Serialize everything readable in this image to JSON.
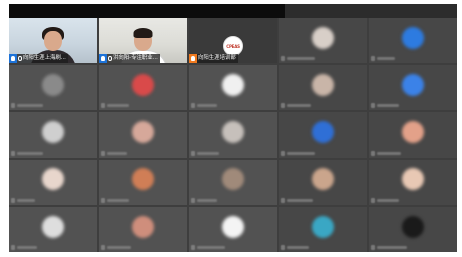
{
  "participants_featured": [
    {
      "name": "向阳生涯上海刷...",
      "icon": "person-icon",
      "mic": "mic-icon",
      "badge_color": "#1e73d8"
    },
    {
      "name": "洪向阳-专注职业...",
      "icon": "person-icon",
      "mic": "mic-icon",
      "badge_color": "#1e73d8"
    },
    {
      "name": "向阳生涯培训部",
      "icon": "person-icon",
      "badge_color": "#f07a1f",
      "logo_text": "CPEAS"
    }
  ],
  "blurred_avatar_colors": [
    "#d8cfc8",
    "#2d7be0",
    "#8a8a8a",
    "#d94a4a",
    "#f0f0f0",
    "#c9b5a8",
    "#3b82e8",
    "#cfcfcf",
    "#d6a89a",
    "#c6c0bb",
    "#2f6fd6",
    "#e3a189",
    "#e8d6cc",
    "#d07e56",
    "#a08a7a",
    "#caa58c",
    "#e8c8b4",
    "#dedede",
    "#cf8e7c",
    "#f4f4f4",
    "#3aa7c4",
    "#1a1a1a"
  ]
}
